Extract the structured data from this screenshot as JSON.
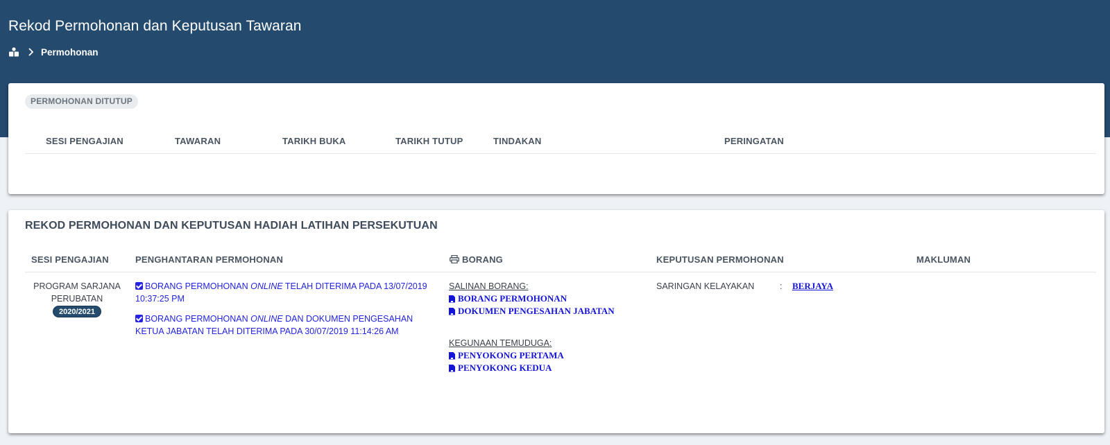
{
  "header": {
    "title": "Rekod Permohonan dan Keputusan Tawaran",
    "breadcrumb": {
      "home_icon": "home-icon",
      "current": "Permohonan"
    }
  },
  "closed_card": {
    "badge": "PERMOHONAN DITUTUP",
    "columns": [
      "SESI PENGAJIAN",
      "TAWARAN",
      "TARIKH BUKA",
      "TARIKH TUTUP",
      "TINDAKAN",
      "PERINGATAN"
    ]
  },
  "record_card": {
    "title": "REKOD PERMOHONAN DAN KEPUTUSAN HADIAH LATIHAN PERSEKUTUAN",
    "columns": {
      "session": "SESI PENGAJIAN",
      "submission": "PENGHANTARAN PERMOHONAN",
      "form": "BORANG",
      "decision": "KEPUTUSAN PERMOHONAN",
      "info": "MAKLUMAN"
    },
    "row": {
      "program": "PROGRAM SARJANA PERUBATAN",
      "year": "2020/2021",
      "submissions": [
        {
          "pre": "BORANG PERMOHONAN ",
          "em": "ONLINE",
          "post": " TELAH DITERIMA PADA 13/07/2019 10:37:25 PM"
        },
        {
          "pre": "BORANG PERMOHONAN ",
          "em": "ONLINE",
          "post": " DAN DOKUMEN PENGESAHAN KETUA JABATAN TELAH DITERIMA PADA 30/07/2019 11:14:26 AM"
        }
      ],
      "form_copy_label": "SALINAN BORANG:",
      "form_links": [
        "BORANG PERMOHONAN",
        "DOKUMEN PENGESAHAN JABATAN"
      ],
      "interview_label": "KEGUNAAN TEMUDUGA:",
      "interview_links": [
        "PENYOKONG PERTAMA",
        "PENYOKONG KEDUA"
      ],
      "decision_label": "SARINGAN KELAYAKAN",
      "decision_sep": ":",
      "decision_value": "BERJAYA"
    }
  },
  "colors": {
    "banner": "#244a6e",
    "link": "#2323e0",
    "badge_bg": "#e9ecef"
  }
}
